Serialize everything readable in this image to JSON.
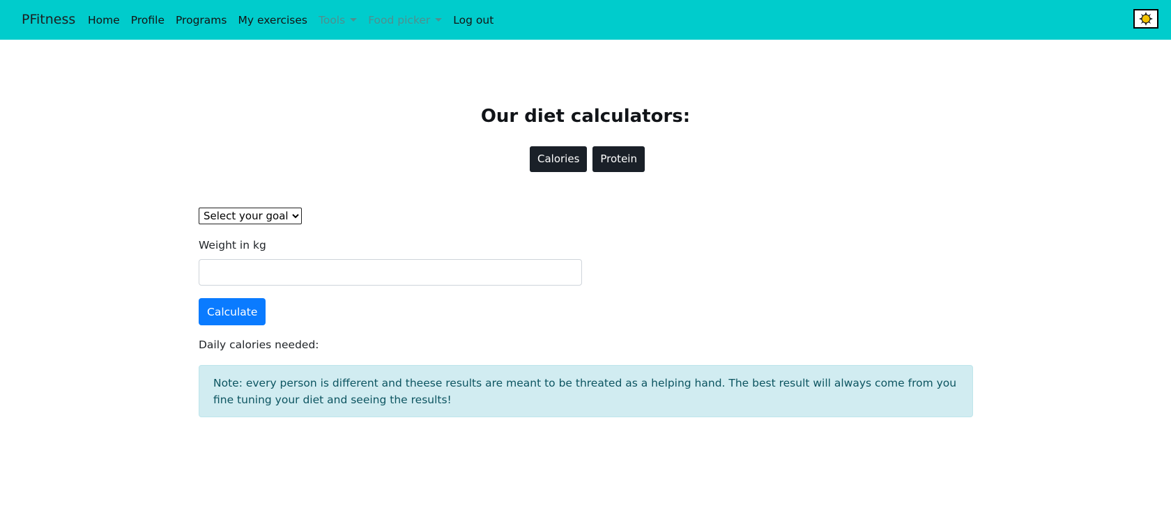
{
  "navbar": {
    "brand": "PFitness",
    "links": [
      {
        "label": "Home"
      },
      {
        "label": "Profile"
      },
      {
        "label": "Programs"
      },
      {
        "label": "My exercises"
      },
      {
        "label": "Tools"
      },
      {
        "label": "Food picker"
      },
      {
        "label": "Log out"
      }
    ],
    "theme_icon": "sun-icon",
    "bg_color": "#00cccc"
  },
  "main": {
    "title": "Our diet calculators:",
    "calculator_buttons": [
      {
        "label": "Calories"
      },
      {
        "label": "Protein"
      }
    ],
    "goal_select": {
      "selected": "Select your goal"
    },
    "weight_label": "Weight in kg",
    "weight_input": {
      "value": "",
      "placeholder": ""
    },
    "calculate_label": "Calculate",
    "result_label": "Daily calories needed:",
    "note": "Note: every person is different and theese results are meant to be threated as a helping hand. The best result will always come from you fine tuning your diet and seeing the results!"
  },
  "colors": {
    "accent": "#00cccc",
    "primary_button": "#0a7bff",
    "dark_button": "#1a2028",
    "note_bg": "#d1ecf1",
    "note_text": "#0c5460"
  }
}
